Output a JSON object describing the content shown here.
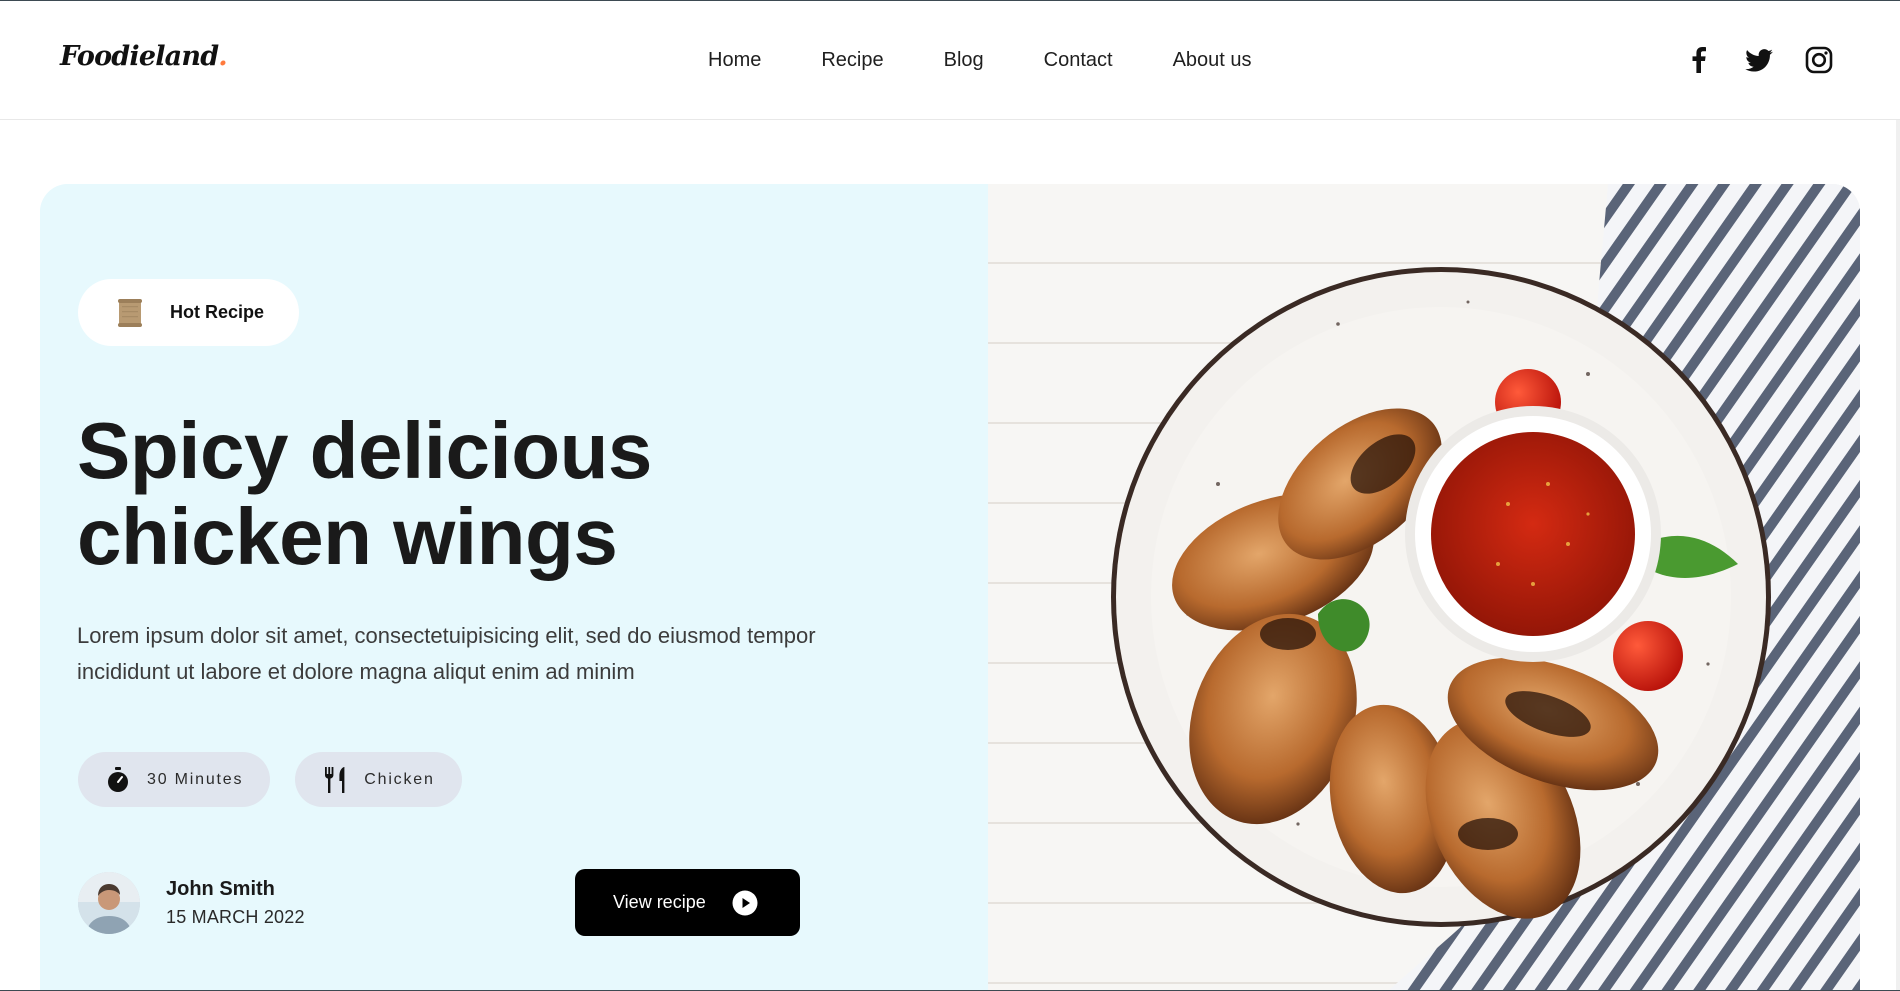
{
  "site": {
    "logo_text": "Foodieland",
    "logo_dot": ".",
    "accent_color": "#ff7a3d"
  },
  "nav": {
    "items": [
      {
        "label": "Home"
      },
      {
        "label": "Recipe"
      },
      {
        "label": "Blog"
      },
      {
        "label": "Contact"
      },
      {
        "label": "About us"
      }
    ]
  },
  "socials": {
    "icons": [
      "facebook-icon",
      "twitter-icon",
      "instagram-icon"
    ]
  },
  "hero": {
    "background_color": "#e7f9fd",
    "badge": {
      "icon": "scroll-icon",
      "label": "Hot Recipe"
    },
    "title": "Spicy delicious chicken wings",
    "description": "Lorem ipsum dolor sit amet, consectetuipisicing elit, sed do eiusmod tempor incididunt ut labore et dolore magna aliqut enim ad minim",
    "chips": [
      {
        "icon": "timer-icon",
        "label": "30 Minutes"
      },
      {
        "icon": "fork-knife-icon",
        "label": "Chicken"
      }
    ],
    "author": {
      "name": "John Smith",
      "date": "15 MARCH 2022"
    },
    "cta": {
      "label": "View recipe",
      "icon": "play-circle-icon"
    },
    "image": {
      "icon": "chicken-wings-photo"
    }
  }
}
